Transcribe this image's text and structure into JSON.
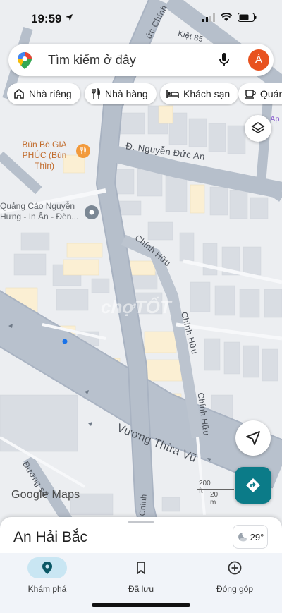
{
  "status": {
    "time": "19:59"
  },
  "search": {
    "placeholder": "Tìm kiếm ở đây",
    "avatar_letter": "Á"
  },
  "chips": [
    {
      "label": "Nhà riêng",
      "icon": "home-icon"
    },
    {
      "label": "Nhà hàng",
      "icon": "restaurant-icon"
    },
    {
      "label": "Khách sạn",
      "icon": "hotel-icon"
    },
    {
      "label": "Quán",
      "icon": "cafe-icon"
    }
  ],
  "map": {
    "pois": {
      "bun_bo": "Bún Bò GIA PHÚC (Bún Thìn)",
      "quang_cao": "Quảng Cáo Nguyễn Hưng - In Ấn - Đèn...",
      "apt": "Ap"
    },
    "streets": {
      "nguyen_duc_an": "Đ. Nguyễn Đức An",
      "chinh_huu_1": "Chính Hữu",
      "chinh_huu_2": "Chính Hữu",
      "chinh_huu_3": "Chính Hữu",
      "vuong_thua_vu": "Vương Thừa Vũ",
      "duong_so": "Đường số",
      "kiet": "Kiệt 85",
      "top_street": "ức Chính",
      "bottom_street": "Chính"
    },
    "watermark": "chợTỐT",
    "google_logo": "Google Maps",
    "scale_ft": "200 ft",
    "scale_m": "20 m"
  },
  "sheet": {
    "title": "An Hải Bắc",
    "temperature": "29°"
  },
  "nav": [
    {
      "label": "Khám phá",
      "icon": "explore-pin-icon",
      "active": true
    },
    {
      "label": "Đã lưu",
      "icon": "bookmark-icon",
      "active": false
    },
    {
      "label": "Đóng góp",
      "icon": "add-circle-icon",
      "active": false
    }
  ],
  "colors": {
    "accent": "#0b7b88",
    "avatar": "#e8521f",
    "road": "#aab4c3",
    "building": "#dadde2",
    "highlight_building": "#fbefd3"
  }
}
